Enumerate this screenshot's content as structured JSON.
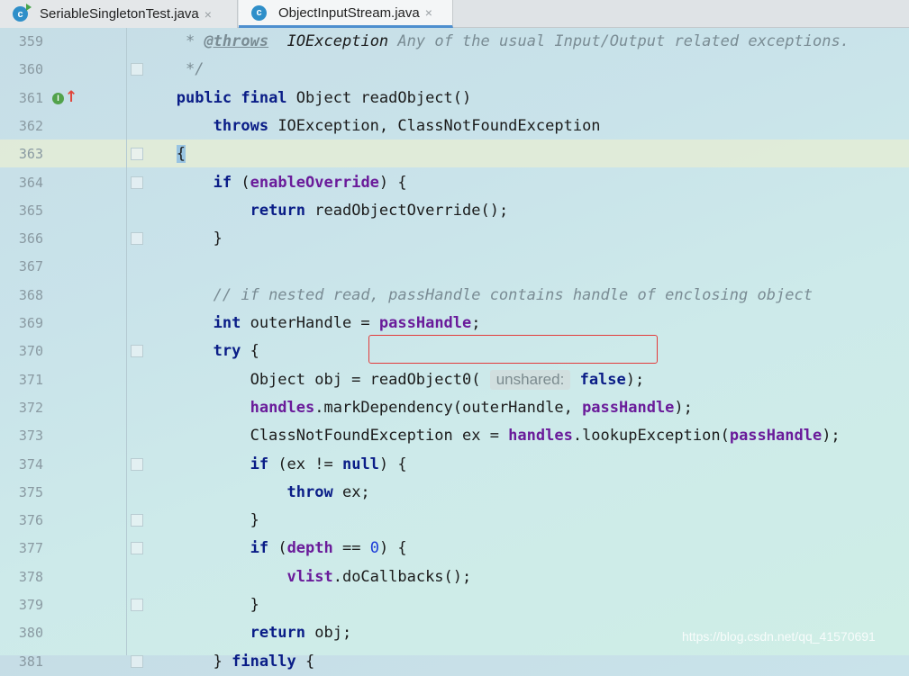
{
  "tabs": [
    {
      "label": "SeriableSingletonTest.java",
      "icon": "java-class-run-icon",
      "close": "×"
    },
    {
      "label": "ObjectInputStream.java",
      "icon": "java-class-icon",
      "close": "×",
      "active": true
    }
  ],
  "gutter_marks": {
    "implements_badge": "I",
    "override_arrow": "↑"
  },
  "inlay_hint": "unshared:",
  "lines": [
    {
      "n": "359",
      "html": "    <span class=\"cm\">* </span><span class=\"doctag\">@throws</span>  <span class=\"cm\" style=\"font-style:italic;color:#1b1b1b\">IOException</span><span class=\"cm\"> Any of the usual Input/Output related exceptions.</span>"
    },
    {
      "n": "360",
      "html": "    <span class=\"cm\">*/</span>"
    },
    {
      "n": "361",
      "html": "   <span class=\"kw\">public final</span> Object readObject()"
    },
    {
      "n": "362",
      "html": "       <span class=\"kw\">throws</span> IOException, ClassNotFoundException"
    },
    {
      "n": "363",
      "html": "   <span class=\"brace-hl\">{</span>"
    },
    {
      "n": "364",
      "html": "       <span class=\"kw\">if</span> (<span class=\"fld\">enableOverride</span>) {"
    },
    {
      "n": "365",
      "html": "           <span class=\"kw\">return</span> readObjectOverride();"
    },
    {
      "n": "366",
      "html": "       }"
    },
    {
      "n": "367",
      "html": ""
    },
    {
      "n": "368",
      "html": "       <span class=\"cm\">// if nested read, passHandle contains handle of enclosing object</span>"
    },
    {
      "n": "369",
      "html": "       <span class=\"kw\">int</span> outerHandle = <span class=\"fld\">passHandle</span>;"
    },
    {
      "n": "370",
      "html": "       <span class=\"kw\">try</span> {"
    },
    {
      "n": "371",
      "html": "           Object obj = readObject0( <span class=\"hint\" data-name=\"inlay-hint-unshared\" data-interactable=\"false\">unshared:</span> <span class=\"kw\">false</span>);"
    },
    {
      "n": "372",
      "html": "           <span class=\"fld\">handles</span>.markDependency(outerHandle, <span class=\"fld\">passHandle</span>);"
    },
    {
      "n": "373",
      "html": "           ClassNotFoundException ex = <span class=\"fld\">handles</span>.lookupException(<span class=\"fld\">passHandle</span>);"
    },
    {
      "n": "374",
      "html": "           <span class=\"kw\">if</span> (ex != <span class=\"kw\">null</span>) {"
    },
    {
      "n": "375",
      "html": "               <span class=\"kw\">throw</span> ex;"
    },
    {
      "n": "376",
      "html": "           }"
    },
    {
      "n": "377",
      "html": "           <span class=\"kw\">if</span> (<span class=\"fld\">depth</span> == <span class=\"num\">0</span>) {"
    },
    {
      "n": "378",
      "html": "               <span class=\"fld\">vlist</span>.doCallbacks();"
    },
    {
      "n": "379",
      "html": "           }"
    },
    {
      "n": "380",
      "html": "           <span class=\"kw\">return</span> obj;"
    },
    {
      "n": "381",
      "html": "       } <span class=\"kw\">finally</span> {"
    }
  ],
  "watermark": "https://blog.csdn.net/qq_41570691"
}
